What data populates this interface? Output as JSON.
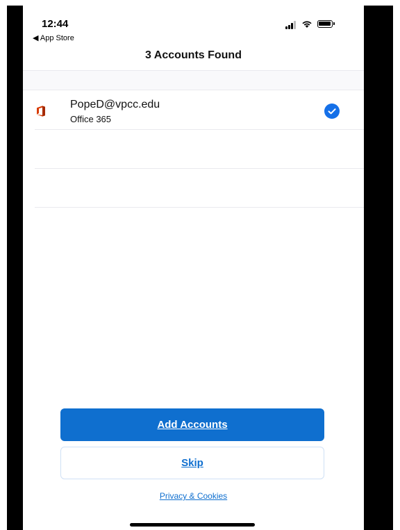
{
  "status_bar": {
    "time": "12:44",
    "back_label": "◀ App Store"
  },
  "nav": {
    "title": "3 Accounts Found"
  },
  "accounts": [
    {
      "email": "PopeD@vpcc.edu",
      "type": "Office 365",
      "icon": "office-icon",
      "selected": true
    }
  ],
  "actions": {
    "primary_label": "Add Accounts",
    "secondary_label": "Skip",
    "privacy_label": "Privacy & Cookies"
  },
  "colors": {
    "accent": "#0f6fcf",
    "check": "#1570e8",
    "office_red": "#d83b01"
  }
}
